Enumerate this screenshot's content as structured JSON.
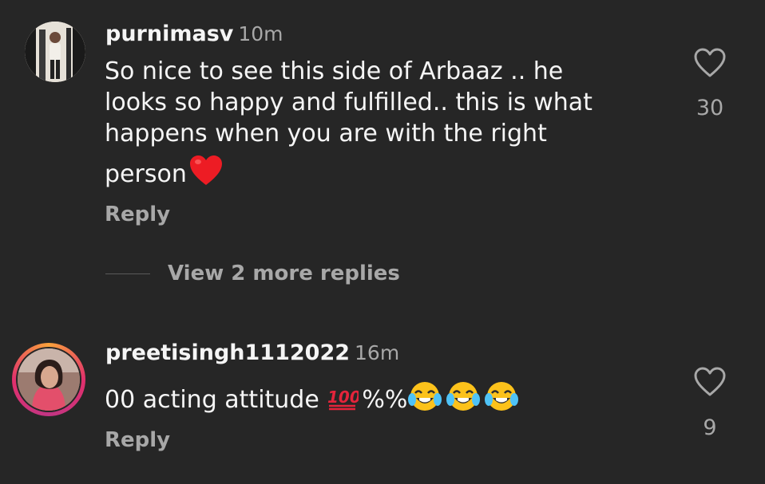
{
  "comments": [
    {
      "username": "purnimasv",
      "time": "10m",
      "text_lines": [
        "So nice to see this side of Arbaaz .. he",
        "looks so happy and fulfilled.. this is what",
        "happens when you are with the right",
        "person"
      ],
      "trailing_emoji": "red-heart",
      "reply_label": "Reply",
      "likes": "30",
      "view_replies_label": "View 2 more replies"
    },
    {
      "username": "preetisingh1112022",
      "time": "16m",
      "text": "00 acting attitude ",
      "text_suffix": "%%",
      "emojis": [
        "hundred-points",
        "tears-of-joy",
        "tears-of-joy",
        "tears-of-joy"
      ],
      "reply_label": "Reply",
      "likes": "9",
      "has_story_ring": true
    }
  ],
  "colors": {
    "background": "#262626",
    "primary_text": "#f5f5f5",
    "secondary_text": "#a8a8a8",
    "heart_red": "#ed1c24"
  }
}
